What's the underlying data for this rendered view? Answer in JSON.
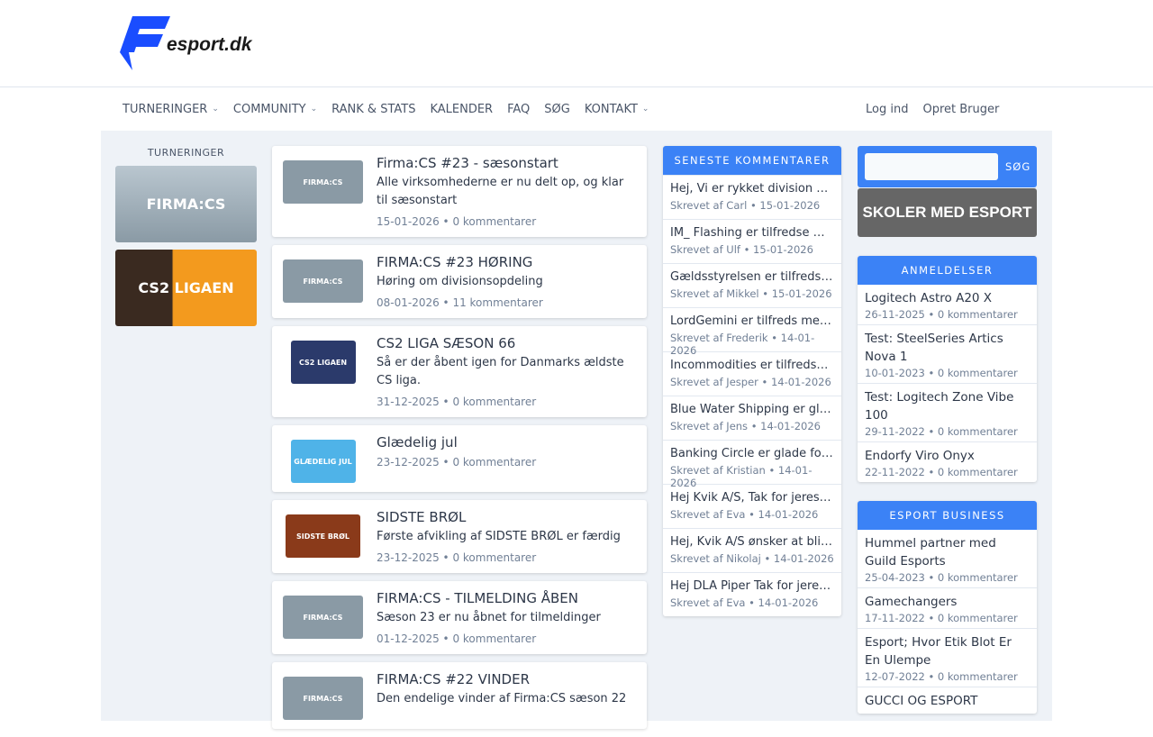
{
  "logo": {
    "text": "esport.dk"
  },
  "nav": {
    "items": [
      {
        "label": "TURNERINGER",
        "dropdown": true
      },
      {
        "label": "COMMUNITY",
        "dropdown": true
      },
      {
        "label": "RANK & STATS"
      },
      {
        "label": "KALENDER"
      },
      {
        "label": "FAQ"
      },
      {
        "label": "SØG"
      },
      {
        "label": "KONTAKT",
        "dropdown": true
      }
    ],
    "login": "Log ind",
    "register": "Opret Bruger"
  },
  "left": {
    "heading": "TURNERINGER",
    "banners": [
      "FIRMA:CS",
      "CS2 LIGAEN"
    ]
  },
  "news": [
    {
      "title": "Firma:CS #23 - sæsonstart",
      "desc": "Alle virksomhederne er nu delt op, og klar til sæsonstart",
      "meta": "15-01-2026 • 0 kommentarer",
      "thumb": "FIRMA:CS",
      "color": "#8a9aa5",
      "w": 89
    },
    {
      "title": "FIRMA:CS #23 HØRING",
      "desc": "Høring om divisionsopdeling",
      "meta": "08-01-2026 • 11 kommentarer",
      "thumb": "FIRMA:CS",
      "color": "#8a9aa5",
      "w": 89
    },
    {
      "title": "CS2 LIGA SÆSON 66",
      "desc": "Så er der åbent igen for Danmarks ældste CS liga.",
      "meta": "31-12-2025 • 0 kommentarer",
      "thumb": "CS2 LIGAEN",
      "color": "#2b3a6b",
      "w": 72
    },
    {
      "title": "Glædelig jul",
      "desc": "",
      "meta": "23-12-2025 • 0 kommentarer",
      "thumb": "GLÆDELIG JUL",
      "color": "#4fb3e8",
      "w": 72
    },
    {
      "title": "SIDSTE BRØL",
      "desc": "Første afvikling af SIDSTE BRØL er færdig",
      "meta": "23-12-2025 • 0 kommentarer",
      "thumb": "SIDSTE BRØL",
      "color": "#8a3a1a",
      "w": 83
    },
    {
      "title": "FIRMA:CS - TILMELDING ÅBEN",
      "desc": "Sæson 23 er nu åbnet for tilmeldinger",
      "meta": "01-12-2025 • 0 kommentarer",
      "thumb": "FIRMA:CS",
      "color": "#8a9aa5",
      "w": 89
    },
    {
      "title": "FIRMA:CS #22 VINDER",
      "desc": "Den endelige vinder af Firma:CS sæson 22",
      "meta": "",
      "thumb": "FIRMA:CS",
      "color": "#8a9aa5",
      "w": 89
    }
  ],
  "comments": {
    "heading": "SENESTE KOMMENTARER",
    "items": [
      {
        "text": "Hej, Vi er rykket division op...",
        "meta": "Skrevet af Carl • 15-01-2026"
      },
      {
        "text": "IM_ Flashing er tilfredse med...",
        "meta": "Skrevet af Ulf • 15-01-2026"
      },
      {
        "text": "Gældsstyrelsen er tilfreds med...",
        "meta": "Skrevet af Mikkel • 15-01-2026"
      },
      {
        "text": "LordGemini er tilfreds med ...",
        "meta": "Skrevet af Frederik • 14-01-2026"
      },
      {
        "text": "Incommodities er tilfredse med...",
        "meta": "Skrevet af Jesper • 14-01-2026"
      },
      {
        "text": "Blue Water Shipping er glade...",
        "meta": "Skrevet af Jens • 14-01-2026"
      },
      {
        "text": "Banking Circle er glade for ...",
        "meta": "Skrevet af Kristian • 14-01-2026"
      },
      {
        "text": "Hej Kvik A/S, Tak for jeres ...",
        "meta": "Skrevet af Eva • 14-01-2026"
      },
      {
        "text": "Hej, Kvik A/S ønsker at blive...",
        "meta": "Skrevet af Nikolaj • 14-01-2026"
      },
      {
        "text": "Hej DLA Piper Tak for jeres ...",
        "meta": "Skrevet af Eva • 14-01-2026"
      }
    ]
  },
  "search": {
    "button": "SØG",
    "value": ""
  },
  "skoler": "SKOLER MED ESPORT",
  "reviews": {
    "heading": "ANMELDELSER",
    "items": [
      {
        "title": "Logitech Astro A20 X",
        "meta": "26-11-2025 • 0 kommentarer"
      },
      {
        "title": "Test: SteelSeries Artics Nova 1",
        "meta": "10-01-2023 • 0 kommentarer"
      },
      {
        "title": "Test: Logitech Zone Vibe 100",
        "meta": "29-11-2022 • 0 kommentarer"
      },
      {
        "title": "Endorfy Viro Onyx",
        "meta": "22-11-2022 • 0 kommentarer"
      }
    ]
  },
  "business": {
    "heading": "ESPORT BUSINESS",
    "items": [
      {
        "title": "Hummel partner med Guild Esports",
        "meta": "25-04-2023 • 0 kommentarer"
      },
      {
        "title": "Gamechangers",
        "meta": "17-11-2022 • 0 kommentarer"
      },
      {
        "title": "Esport; Hvor Etik Blot Er En Ulempe",
        "meta": "12-07-2022 • 0 kommentarer"
      },
      {
        "title": "GUCCI OG ESPORT",
        "meta": ""
      }
    ]
  }
}
